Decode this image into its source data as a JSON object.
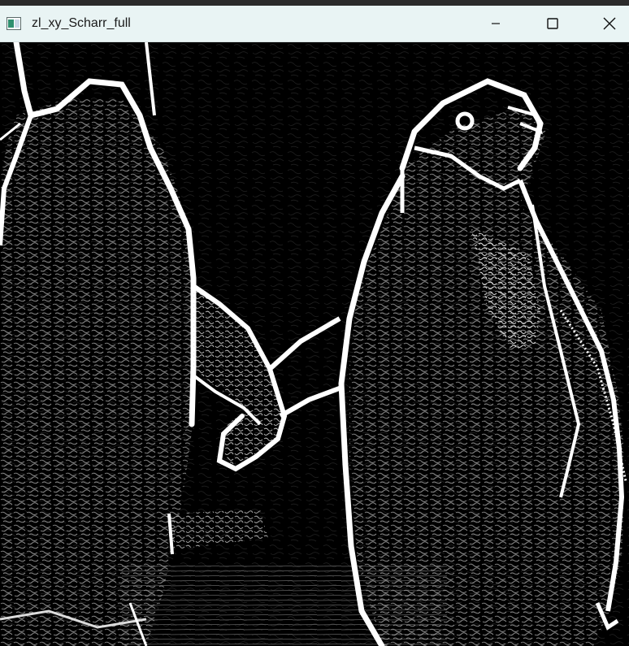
{
  "window": {
    "title": "zl_xy_Scharr_full",
    "app_icon": "opencv-window-icon",
    "controls": {
      "minimize_icon": "minimize-icon",
      "maximize_icon": "maximize-icon",
      "close_icon": "close-icon"
    }
  },
  "image": {
    "content": "edge-detection-penguins",
    "colors": {
      "background": "#000000",
      "edges": "#ffffff"
    }
  }
}
